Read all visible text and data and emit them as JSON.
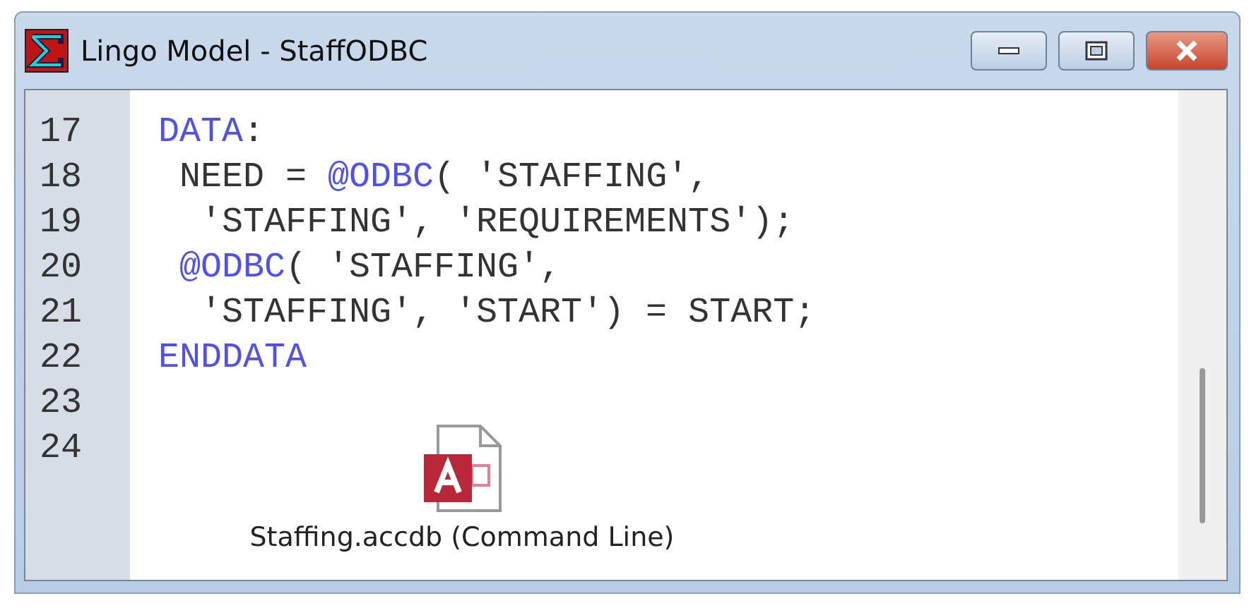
{
  "window": {
    "title": "Lingo Model - StaffODBC"
  },
  "editor": {
    "lines": [
      {
        "number": "17",
        "tokens": [
          {
            "text": "DATA",
            "kind": "keyword"
          },
          {
            "text": ":",
            "kind": "plain"
          }
        ]
      },
      {
        "number": "18",
        "tokens": [
          {
            "text": " NEED = ",
            "kind": "plain"
          },
          {
            "text": "@ODBC",
            "kind": "keyword"
          },
          {
            "text": "( 'STAFFING',",
            "kind": "plain"
          }
        ]
      },
      {
        "number": "19",
        "tokens": [
          {
            "text": "  'STAFFING', 'REQUIREMENTS');",
            "kind": "plain"
          }
        ]
      },
      {
        "number": "20",
        "tokens": [
          {
            "text": " @ODBC",
            "kind": "keyword"
          },
          {
            "text": "( 'STAFFING',",
            "kind": "plain"
          }
        ]
      },
      {
        "number": "21",
        "tokens": [
          {
            "text": "  'STAFFING', 'START') = START;",
            "kind": "plain"
          }
        ]
      },
      {
        "number": "22",
        "tokens": [
          {
            "text": "ENDDATA",
            "kind": "keyword"
          }
        ]
      },
      {
        "number": "23"
      },
      {
        "number": "24"
      }
    ],
    "file_icon": {
      "label": "Staffing.accdb (Command Line)"
    }
  }
}
